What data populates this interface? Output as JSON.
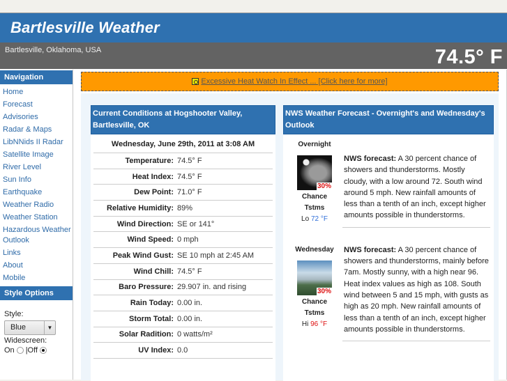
{
  "header": {
    "title": "Bartlesville Weather",
    "location": "Bartlesville, Oklahoma, USA",
    "current_temp": "74.5° F"
  },
  "sidebar": {
    "nav_heading": "Navigation",
    "items": [
      {
        "label": "Home"
      },
      {
        "label": "Forecast"
      },
      {
        "label": "Advisories"
      },
      {
        "label": "Radar & Maps"
      },
      {
        "label": "LibNNids II Radar"
      },
      {
        "label": "Satellite Image"
      },
      {
        "label": "River Level"
      },
      {
        "label": "Sun Info"
      },
      {
        "label": "Earthquake"
      },
      {
        "label": "Weather Radio"
      },
      {
        "label": "Weather Station"
      },
      {
        "label": "Hazardous Weather Outlook"
      },
      {
        "label": "Links"
      },
      {
        "label": "About"
      },
      {
        "label": "Mobile"
      }
    ],
    "style_heading": "Style Options",
    "style_label": "Style:",
    "style_value": "Blue",
    "widescreen_label": "Widescreen:",
    "widescreen_on": "On",
    "widescreen_off": "|Off",
    "widescreen_selected": "Off"
  },
  "alert": {
    "icon": "alert-icon",
    "text": "Excessive Heat Watch In Effect ... [Click here for more]",
    "color": "#ff9900"
  },
  "current": {
    "heading": "Current Conditions at Hogshooter Valley, Bartlesville, OK",
    "date": "Wednesday, June 29th, 2011 at 3:08 AM",
    "rows": [
      {
        "label": "Temperature:",
        "value": "74.5° F"
      },
      {
        "label": "Heat Index:",
        "value": "74.5° F"
      },
      {
        "label": "Dew Point:",
        "value": "71.0° F"
      },
      {
        "label": "Relative Humidity:",
        "value": "89%"
      },
      {
        "label": "Wind Direction:",
        "value": "SE or 141°"
      },
      {
        "label": "Wind Speed:",
        "value": "0 mph"
      },
      {
        "label": "Peak Wind Gust:",
        "value": "SE 10 mph at 2:45 AM"
      },
      {
        "label": "Wind Chill:",
        "value": "74.5° F"
      },
      {
        "label": "Baro Pressure:",
        "value": "29.907 in. and rising"
      },
      {
        "label": "Rain Today:",
        "value": "0.00 in."
      },
      {
        "label": "Storm Total:",
        "value": "0.00 in."
      },
      {
        "label": "Solar Radition:",
        "value": "0 watts/m²"
      },
      {
        "label": "UV Index:",
        "value": "0.0"
      }
    ]
  },
  "forecast": {
    "heading": "NWS Weather Forecast  -  Overnight's and Wednesday's Outlook",
    "days": [
      {
        "name": "Overnight",
        "icon": "night-thunderstorm-image",
        "pct": "30%",
        "cond1": "Chance",
        "cond2": "Tstms",
        "temp_prefix": "Lo",
        "temp": "72 °F",
        "lead": "NWS forecast:",
        "text": " A 30 percent chance of showers and thunderstorms. Mostly cloudy, with a low around 72. South wind around 5 mph. New rainfall amounts of less than a tenth of an inch, except higher amounts possible in thunderstorms."
      },
      {
        "name": "Wednesday",
        "icon": "day-thunderstorm-image",
        "pct": "30%",
        "cond1": "Chance",
        "cond2": "Tstms",
        "temp_prefix": "Hi",
        "temp": "96 °F",
        "lead": "NWS forecast:",
        "text": " A 30 percent chance of showers and thunderstorms, mainly before 7am. Mostly sunny, with a high near 96. Heat index values as high as 108. South wind between 5 and 15 mph, with gusts as high as 20 mph. New rainfall amounts of less than a tenth of an inch, except higher amounts possible in thunderstorms."
      }
    ]
  },
  "colors": {
    "brand_blue": "#2f71b0",
    "subbar_gray": "#636363",
    "alert_orange": "#ff9900",
    "low_temp": "#2f6ed8",
    "high_temp": "#dd1111"
  }
}
